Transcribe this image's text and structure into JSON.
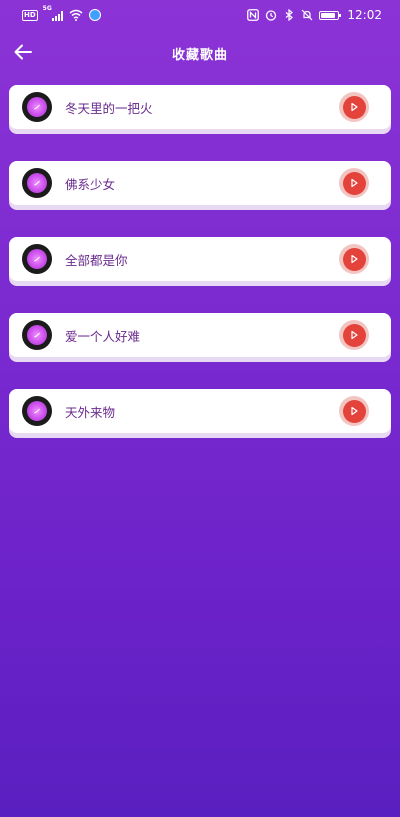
{
  "status_bar": {
    "hd": "HD",
    "network": "5G",
    "time": "12:02",
    "battery_level": 0.85
  },
  "header": {
    "title": "收藏歌曲"
  },
  "songs": [
    {
      "title": "冬天里的一把火"
    },
    {
      "title": "佛系少女"
    },
    {
      "title": "全部都是你"
    },
    {
      "title": "爱一个人好难"
    },
    {
      "title": "天外来物"
    }
  ],
  "colors": {
    "background_top": "#8c33d6",
    "background_bottom": "#5a1fc0",
    "play_button": "#e3433a",
    "song_text": "#6a2b8e"
  },
  "icons": {
    "back": "arrow-left-icon",
    "play": "play-icon",
    "disc": "vinyl-disc-icon"
  }
}
